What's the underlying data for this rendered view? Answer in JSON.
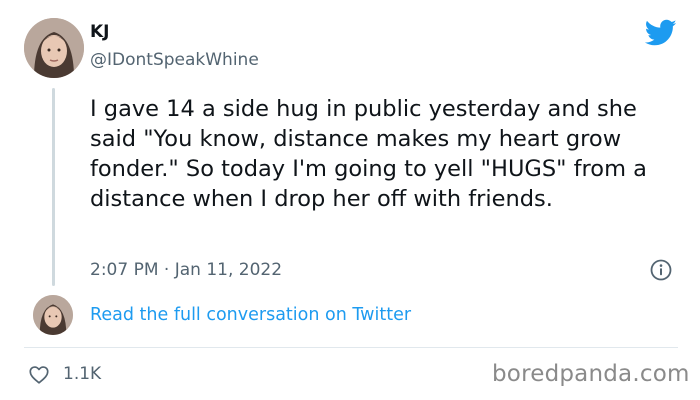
{
  "tweet": {
    "author_name": "KJ",
    "author_handle": "@IDontSpeakWhine",
    "text": "I gave 14 a side hug in public yesterday and she said \"You know, distance makes my heart grow fonder.\" So today I'm going to yell \"HUGS\" from a distance when I drop her off with friends.",
    "timestamp": "2:07 PM · Jan 11, 2022"
  },
  "conversation_link": "Read the full conversation on Twitter",
  "likes": "1.1K",
  "watermark": "boredpanda.com",
  "icons": {
    "brand": "twitter-bird-icon",
    "info": "info-icon",
    "like": "heart-icon"
  },
  "colors": {
    "link": "#1d9bf0",
    "twitter_brand": "#1d9bf0",
    "secondary_text": "#536471",
    "primary_text": "#0f1419"
  }
}
